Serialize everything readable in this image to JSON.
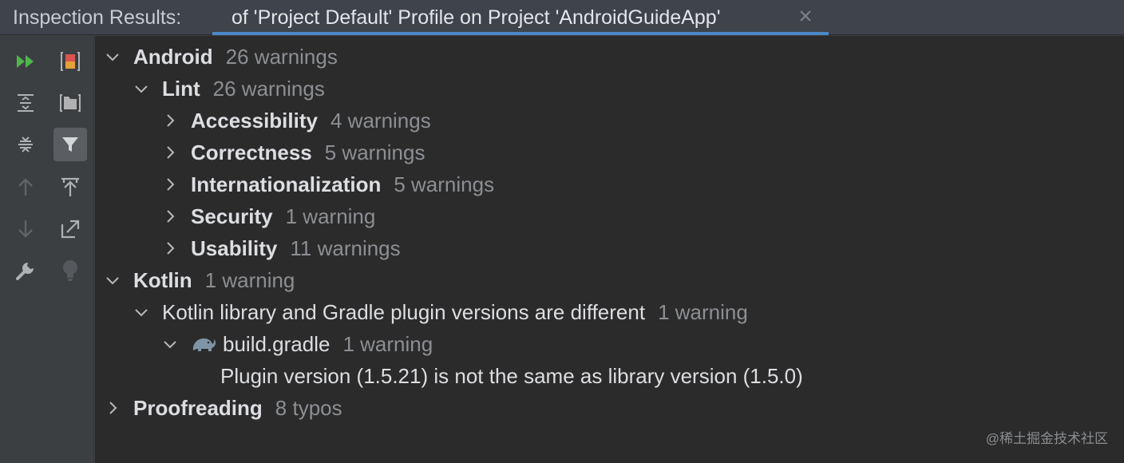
{
  "panel": {
    "label": "Inspection Results:",
    "tab_title": "of 'Project Default' Profile on Project 'AndroidGuideApp'"
  },
  "toolbar": {
    "left_column": [
      "rerun-icon",
      "expand-all-icon",
      "collapse-all-icon",
      "previous-occurrence-icon",
      "next-occurrence-icon",
      "settings-wrench-icon"
    ],
    "right_column": [
      "stop-icon",
      "group-by-icon",
      "filter-icon",
      "export-icon",
      "open-in-editor-icon",
      "quick-fix-bulb-icon"
    ],
    "active_tool": "filter-icon"
  },
  "tree": {
    "android": {
      "label": "Android",
      "count": "26 warnings",
      "expanded": true
    },
    "lint": {
      "label": "Lint",
      "count": "26 warnings",
      "expanded": true
    },
    "accessibility": {
      "label": "Accessibility",
      "count": "4 warnings"
    },
    "correctness": {
      "label": "Correctness",
      "count": "5 warnings"
    },
    "internationalization": {
      "label": "Internationalization",
      "count": "5 warnings"
    },
    "security": {
      "label": "Security",
      "count": "1 warning"
    },
    "usability": {
      "label": "Usability",
      "count": "11 warnings"
    },
    "kotlin": {
      "label": "Kotlin",
      "count": "1 warning",
      "expanded": true
    },
    "kotlin_versions": {
      "label": "Kotlin library and Gradle plugin versions are different",
      "count": "1 warning",
      "expanded": true
    },
    "build_gradle": {
      "label": "build.gradle",
      "count": "1 warning",
      "expanded": true
    },
    "problem": {
      "label": "Plugin version (1.5.21) is not the same as library version (1.5.0)"
    },
    "proofreading": {
      "label": "Proofreading",
      "count": "8 typos"
    }
  },
  "watermark": "@稀土掘金技术社区",
  "colors": {
    "background": "#2b2b2b",
    "toolbar": "#3c3f41",
    "tab_underline": "#4a88c7",
    "run_green": "#4fb54b",
    "count_gray": "#8c8f93"
  }
}
